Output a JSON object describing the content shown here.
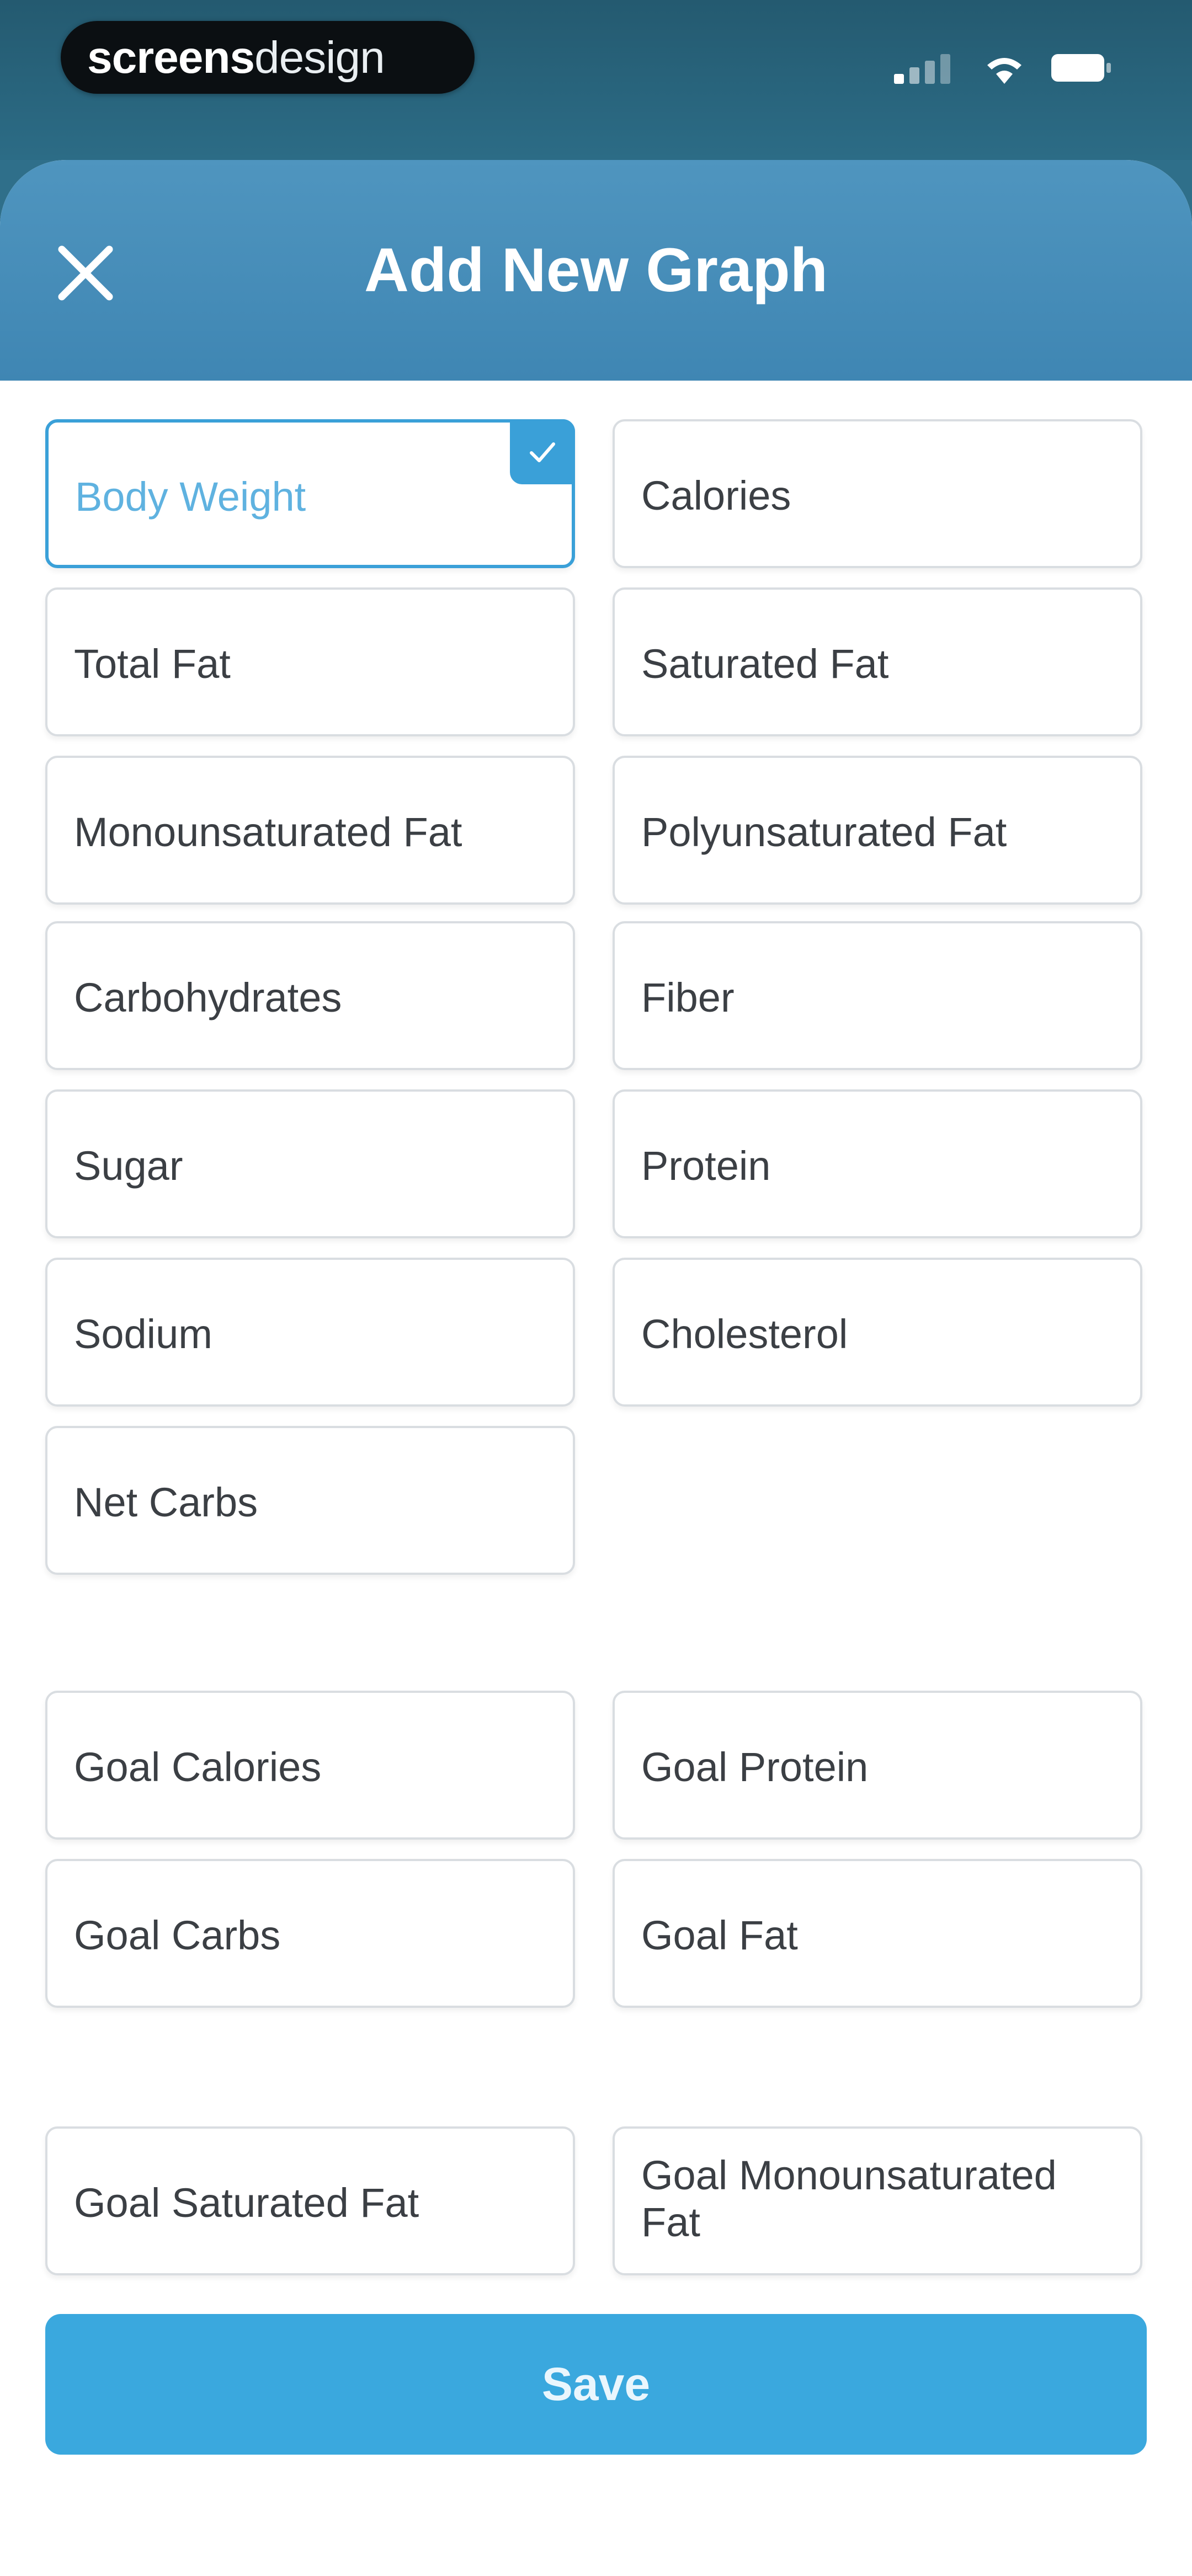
{
  "status_bar": {
    "brand_bold": "screens",
    "brand_light": "design"
  },
  "header": {
    "title": "Add New Graph"
  },
  "options": [
    {
      "label": "Body Weight",
      "selected": true
    },
    {
      "label": "Calories",
      "selected": false
    },
    {
      "label": "Total Fat",
      "selected": false
    },
    {
      "label": "Saturated Fat",
      "selected": false
    },
    {
      "label": "Monounsaturated Fat",
      "selected": false
    },
    {
      "label": "Polyunsaturated Fat",
      "selected": false
    },
    {
      "label": "Carbohydrates",
      "selected": false
    },
    {
      "label": "Fiber",
      "selected": false
    },
    {
      "label": "Sugar",
      "selected": false
    },
    {
      "label": "Protein",
      "selected": false
    },
    {
      "label": "Sodium",
      "selected": false
    },
    {
      "label": "Cholesterol",
      "selected": false
    },
    {
      "label": "Net Carbs",
      "selected": false
    },
    {
      "label": "Goal Calories",
      "selected": false
    },
    {
      "label": "Goal Protein",
      "selected": false
    },
    {
      "label": "Goal Carbs",
      "selected": false
    },
    {
      "label": "Goal Fat",
      "selected": false
    },
    {
      "label": "Goal Saturated Fat",
      "selected": false
    },
    {
      "label": "Goal Monounsaturated Fat",
      "selected": false
    }
  ],
  "footer": {
    "save_label": "Save"
  },
  "colors": {
    "accent": "#3aa0d8",
    "header": "#4a90ba",
    "save_button": "#3aa8de",
    "card_border": "#d9dde1",
    "text": "#3b3f44"
  }
}
